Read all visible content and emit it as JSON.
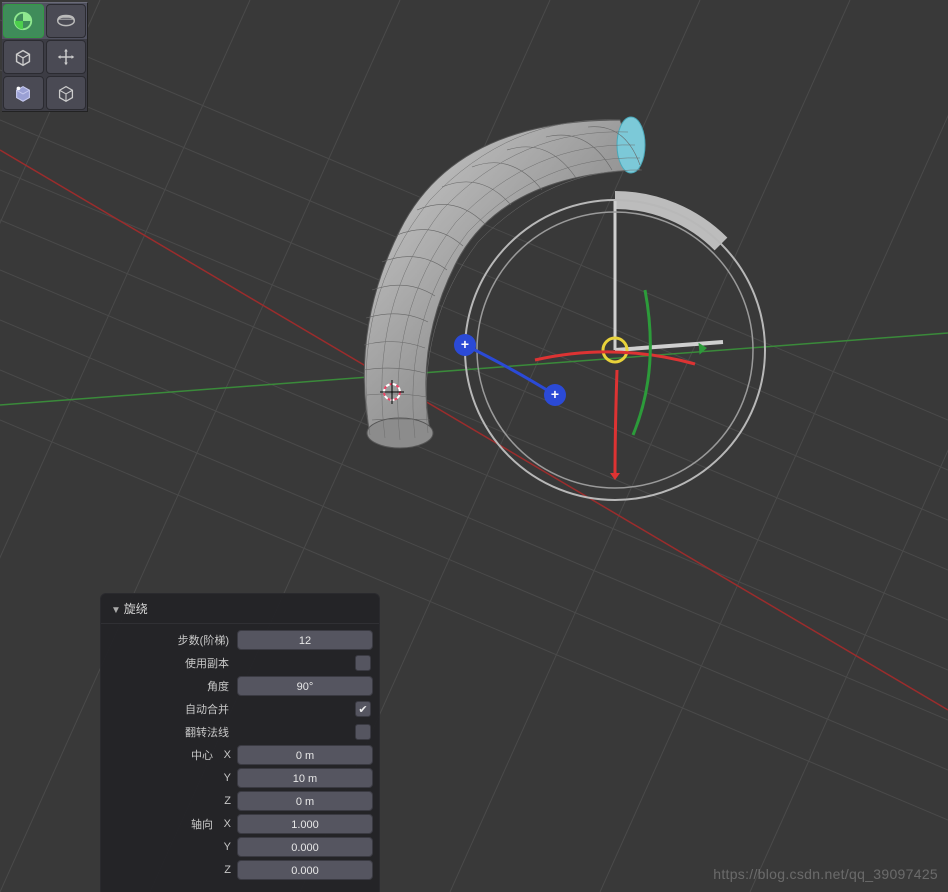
{
  "panel": {
    "title": "旋绕",
    "steps_label": "步数(阶梯)",
    "steps_value": "12",
    "use_copy_label": "使用副本",
    "use_copy_checked": false,
    "angle_label": "角度",
    "angle_value": "90°",
    "auto_merge_label": "自动合并",
    "auto_merge_checked": true,
    "flip_normals_label": "翻转法线",
    "flip_normals_checked": false,
    "center_group": "中心",
    "axis_group": "轴向",
    "center": {
      "x_label": "X",
      "x": "0 m",
      "y_label": "Y",
      "y": "10 m",
      "z_label": "Z",
      "z": "0 m"
    },
    "axis": {
      "x_label": "X",
      "x": "1.000",
      "y_label": "Y",
      "y": "0.000",
      "z_label": "Z",
      "z": "0.000"
    }
  },
  "watermark": "https://blog.csdn.net/qq_39097425",
  "tools": [
    [
      "add-primitive",
      "extrude-region"
    ],
    [
      "cube",
      "move"
    ],
    [
      "bevel",
      "edge"
    ]
  ]
}
